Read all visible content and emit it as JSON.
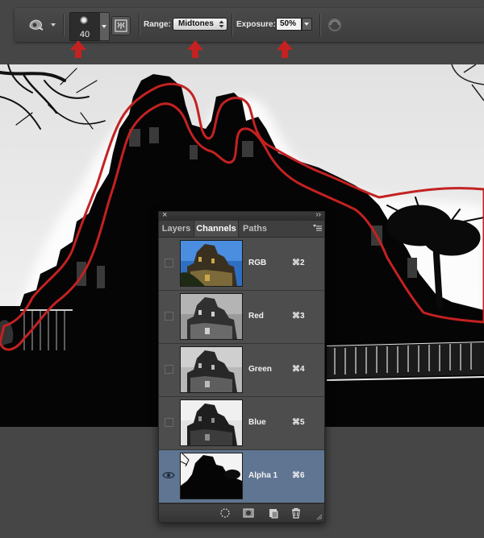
{
  "options_bar": {
    "brush_size": "40",
    "range_label": "Range:",
    "range_value": "Midtones",
    "exposure_label": "Exposure:",
    "exposure_value": "50%"
  },
  "channels_panel": {
    "tabs": [
      {
        "label": "Layers",
        "active": false
      },
      {
        "label": "Channels",
        "active": true
      },
      {
        "label": "Paths",
        "active": false
      }
    ],
    "channels": [
      {
        "name": "RGB",
        "shortcut": "⌘2",
        "visible": false,
        "selected": false
      },
      {
        "name": "Red",
        "shortcut": "⌘3",
        "visible": false,
        "selected": false
      },
      {
        "name": "Green",
        "shortcut": "⌘4",
        "visible": false,
        "selected": false
      },
      {
        "name": "Blue",
        "shortcut": "⌘5",
        "visible": false,
        "selected": false
      },
      {
        "name": "Alpha 1",
        "shortcut": "⌘6",
        "visible": true,
        "selected": true
      }
    ]
  },
  "colors": {
    "annotation_red": "#c42121",
    "selection_blue": "#5f7591"
  }
}
